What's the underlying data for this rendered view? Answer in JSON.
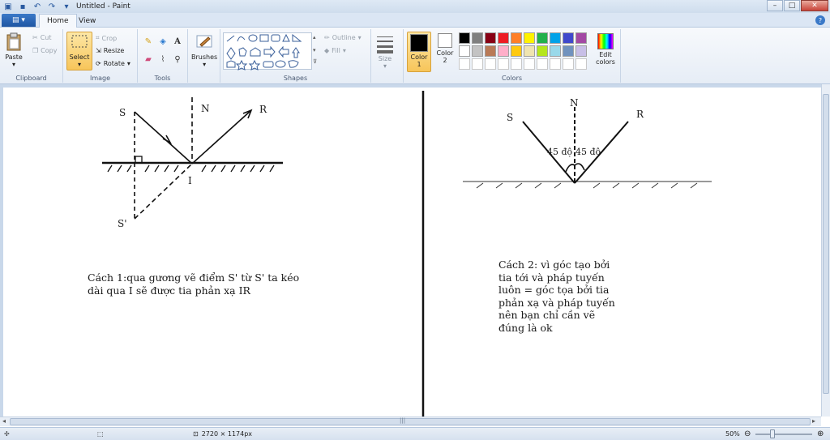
{
  "window": {
    "title": "Untitled - Paint"
  },
  "tabs": {
    "file_label": "▤ ▾",
    "home": "Home",
    "view": "View"
  },
  "ribbon": {
    "clipboard": {
      "group_label": "Clipboard",
      "paste": "Paste",
      "cut": "Cut",
      "copy": "Copy"
    },
    "image": {
      "group_label": "Image",
      "select": "Select",
      "crop": "Crop",
      "resize": "Resize",
      "rotate": "Rotate"
    },
    "tools": {
      "group_label": "Tools"
    },
    "brushes": {
      "label": "Brushes"
    },
    "shapes": {
      "group_label": "Shapes",
      "outline": "Outline",
      "fill": "Fill"
    },
    "size": {
      "label": "Size"
    },
    "colors": {
      "group_label": "Colors",
      "color1_line1": "Color",
      "color1_line2": "1",
      "color2_line1": "Color",
      "color2_line2": "2",
      "edit_line1": "Edit",
      "edit_line2": "colors",
      "color1_value": "#000000",
      "color2_value": "#ffffff",
      "palette_row1": [
        "#000000",
        "#7f7f7f",
        "#880015",
        "#ed1c24",
        "#ff7f27",
        "#fff200",
        "#22b14c",
        "#00a2e8",
        "#3f48cc",
        "#a349a4"
      ],
      "palette_row2": [
        "#ffffff",
        "#c3c3c3",
        "#b97a57",
        "#ffaec9",
        "#ffc90e",
        "#efe4b0",
        "#b5e61d",
        "#99d9ea",
        "#7092be",
        "#c8bfe7"
      ]
    }
  },
  "canvas": {
    "diagram1": {
      "label_s": "S",
      "label_n": "N",
      "label_r": "R",
      "label_i": "I",
      "label_s_prime": "S'"
    },
    "diagram2": {
      "label_s": "S",
      "label_n": "N",
      "label_r": "R",
      "angle_left": "45 độ",
      "angle_right": "45 độ"
    },
    "note1": "Cách 1:qua gương vẽ điểm S' từ S' ta kéo\ndài qua I sẽ được tia phản xạ IR",
    "note2": "Cách 2: vì góc tạo bởi\ntia tới và pháp tuyến\nluôn = góc tọa bởi tia\nphản xạ và pháp tuyến\nnên bạn chỉ cần vẽ\nđúng là ok"
  },
  "status": {
    "image_size": "2720 × 1174px",
    "zoom": "50%"
  }
}
